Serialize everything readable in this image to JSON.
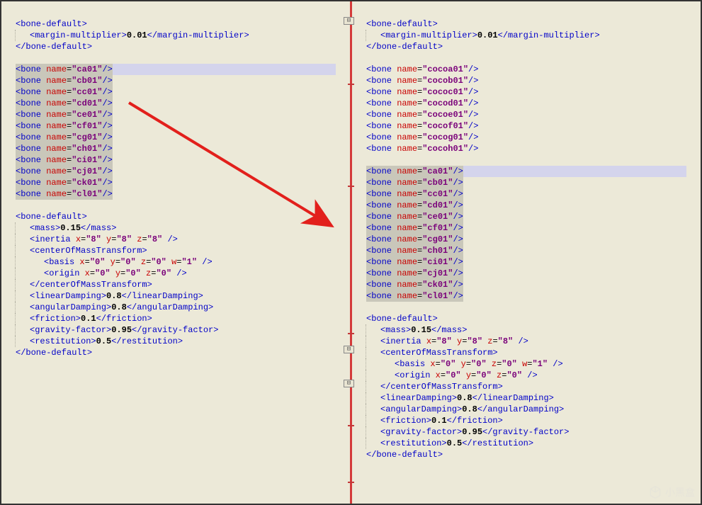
{
  "left": {
    "boneDefault1": {
      "open": "<bone-default>",
      "marginOpen": "<margin-multiplier>",
      "marginVal": "0.01",
      "marginClose": "</margin-multiplier>",
      "close": "</bone-default>"
    },
    "bones": [
      "ca01",
      "cb01",
      "cc01",
      "cd01",
      "ce01",
      "cf01",
      "cg01",
      "ch01",
      "ci01",
      "cj01",
      "ck01",
      "cl01"
    ],
    "boneDefault2": {
      "open": "<bone-default>",
      "mass": {
        "open": "<mass>",
        "val": "0.15",
        "close": "</mass>"
      },
      "inertia": {
        "tag": "inertia",
        "x": "8",
        "y": "8",
        "z": "8"
      },
      "com": {
        "open": "<centerOfMassTransform>",
        "close": "</centerOfMassTransform>"
      },
      "basis": {
        "tag": "basis",
        "x": "0",
        "y": "0",
        "z": "0",
        "w": "1"
      },
      "origin": {
        "tag": "origin",
        "x": "0",
        "y": "0",
        "z": "0"
      },
      "linDamp": {
        "open": "<linearDamping>",
        "val": "0.8",
        "close": "</linearDamping>"
      },
      "angDamp": {
        "open": "<angularDamping>",
        "val": "0.8",
        "close": "</angularDamping>"
      },
      "friction": {
        "open": "<friction>",
        "val": "0.1",
        "close": "</friction>"
      },
      "gravity": {
        "open": "<gravity-factor>",
        "val": "0.95",
        "close": "</gravity-factor>"
      },
      "rest": {
        "open": "<restitution>",
        "val": "0.5",
        "close": "</restitution>"
      },
      "close": "</bone-default>"
    }
  },
  "right": {
    "boneDefault1": {
      "open": "<bone-default>",
      "marginOpen": "<margin-multiplier>",
      "marginVal": "0.01",
      "marginClose": "</margin-multiplier>",
      "close": "</bone-default>"
    },
    "cocoBones": [
      "cocoa01",
      "cocob01",
      "cococ01",
      "cocod01",
      "cocoe01",
      "cocof01",
      "cocog01",
      "cocoh01"
    ],
    "bones": [
      "ca01",
      "cb01",
      "cc01",
      "cd01",
      "ce01",
      "cf01",
      "cg01",
      "ch01",
      "ci01",
      "cj01",
      "ck01",
      "cl01"
    ],
    "boneDefault2": {
      "open": "<bone-default>",
      "mass": {
        "open": "<mass>",
        "val": "0.15",
        "close": "</mass>"
      },
      "inertia": {
        "tag": "inertia",
        "x": "8",
        "y": "8",
        "z": "8"
      },
      "com": {
        "open": "<centerOfMassTransform>",
        "close": "</centerOfMassTransform>"
      },
      "basis": {
        "tag": "basis",
        "x": "0",
        "y": "0",
        "z": "0",
        "w": "1"
      },
      "origin": {
        "tag": "origin",
        "x": "0",
        "y": "0",
        "z": "0"
      },
      "linDamp": {
        "open": "<linearDamping>",
        "val": "0.8",
        "close": "</linearDamping>"
      },
      "angDamp": {
        "open": "<angularDamping>",
        "val": "0.8",
        "close": "</angularDamping>"
      },
      "friction": {
        "open": "<friction>",
        "val": "0.1",
        "close": "</friction>"
      },
      "gravity": {
        "open": "<gravity-factor>",
        "val": "0.95",
        "close": "</gravity-factor>"
      },
      "rest": {
        "open": "<restitution>",
        "val": "0.5",
        "close": "</restitution>"
      },
      "close": "</bone-default>"
    }
  },
  "labels": {
    "bone": "bone",
    "name": "name",
    "watermark": "小黑盒"
  }
}
